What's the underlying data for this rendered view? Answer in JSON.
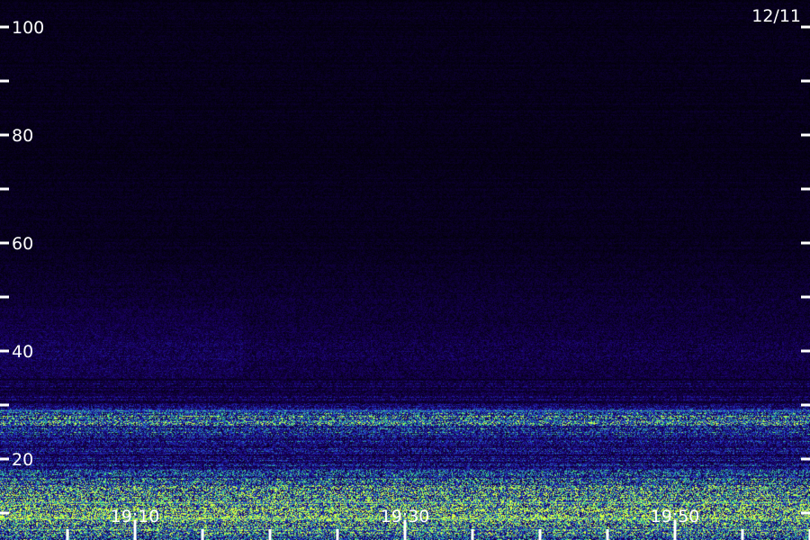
{
  "date_label": "12/11",
  "chart_data": {
    "type": "heatmap",
    "title": "",
    "xlabel": "",
    "ylabel": "",
    "x_ticks": [
      "19:10",
      "19:30",
      "19:50"
    ],
    "y_ticks": [
      100,
      80,
      60,
      40,
      20
    ],
    "ylim": [
      0,
      100
    ],
    "intensity_profile": {
      "frequency": [
        100,
        80,
        60,
        45,
        40,
        35,
        30,
        28,
        24,
        20,
        15,
        10,
        5
      ],
      "level": [
        0.1,
        0.1,
        0.12,
        0.22,
        0.28,
        0.25,
        0.3,
        0.75,
        0.45,
        0.4,
        0.7,
        0.9,
        0.65
      ]
    },
    "bands": [
      {
        "frequency": 29,
        "level": 0.8
      },
      {
        "frequency": 27,
        "level": 0.7
      },
      {
        "frequency": 12,
        "level": 0.85
      },
      {
        "frequency": 9,
        "level": 1.0
      },
      {
        "frequency": 7,
        "level": 0.75
      }
    ],
    "grid": false,
    "colors": {
      "low": "#1a0066",
      "mid": "#2233cc",
      "high": "#33dd88",
      "peak": "#ddff44",
      "axis": "#ffffff"
    }
  }
}
